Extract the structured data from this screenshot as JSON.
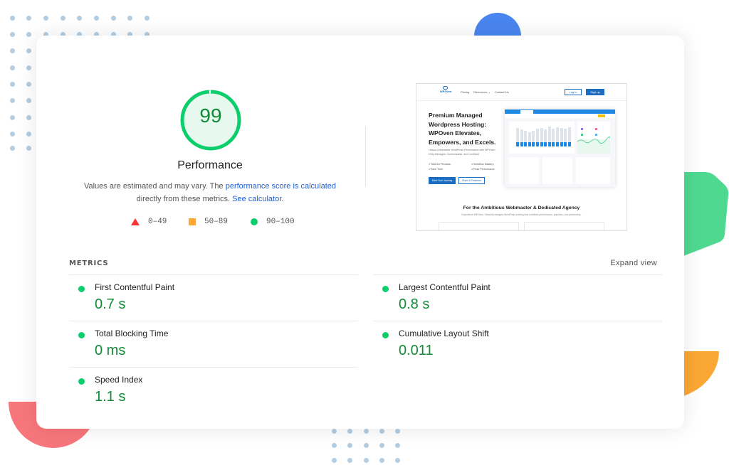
{
  "performance": {
    "score": "99",
    "score_fraction": 0.99,
    "title": "Performance",
    "description_prefix": "Values are estimated and may vary. The ",
    "description_link1": "performance score is calculated",
    "description_middle": " directly from these metrics. ",
    "description_link2": "See calculator",
    "description_suffix": ".",
    "colors": {
      "pass": "#0cce6b",
      "average": "#ffa633",
      "fail": "#ff3333",
      "pass_text": "#118a36"
    },
    "legend": [
      {
        "shape": "triangle",
        "range": "0–49"
      },
      {
        "shape": "square",
        "range": "50–89"
      },
      {
        "shape": "circle",
        "range": "90–100"
      }
    ]
  },
  "screenshot": {
    "logo": "WPOven",
    "nav": [
      "Pricing",
      "Resources ⌄",
      "Contact Us"
    ],
    "login": "Log in",
    "signup": "Sign up",
    "headline": "Premium Managed Wordpress Hosting: WPOven Elevates, Empowers, and Excels.",
    "subtext": "Unlock Unbeatable WordPress Performance with WPOven: Fully Managed, Customizable, and Limitless!",
    "features": [
      "Tailored Precision",
      "Workflow Mastery",
      "Save Time",
      "Peak Performance"
    ],
    "cta_primary": "Start Your Journey",
    "cta_secondary": "Plans & Features",
    "section_title": "For the Ambitious Webmaster & Dedicated Agency",
    "section_subtitle": "Experience WPOven: Tailored managed WordPress hosting that redefines performance, precision, and partnership."
  },
  "metrics": {
    "title": "METRICS",
    "expand_label": "Expand view",
    "items": [
      {
        "label": "First Contentful Paint",
        "value": "0.7 s",
        "status": "pass"
      },
      {
        "label": "Largest Contentful Paint",
        "value": "0.8 s",
        "status": "pass"
      },
      {
        "label": "Total Blocking Time",
        "value": "0 ms",
        "status": "pass"
      },
      {
        "label": "Cumulative Layout Shift",
        "value": "0.011",
        "status": "pass"
      },
      {
        "label": "Speed Index",
        "value": "1.1 s",
        "status": "pass"
      }
    ]
  }
}
